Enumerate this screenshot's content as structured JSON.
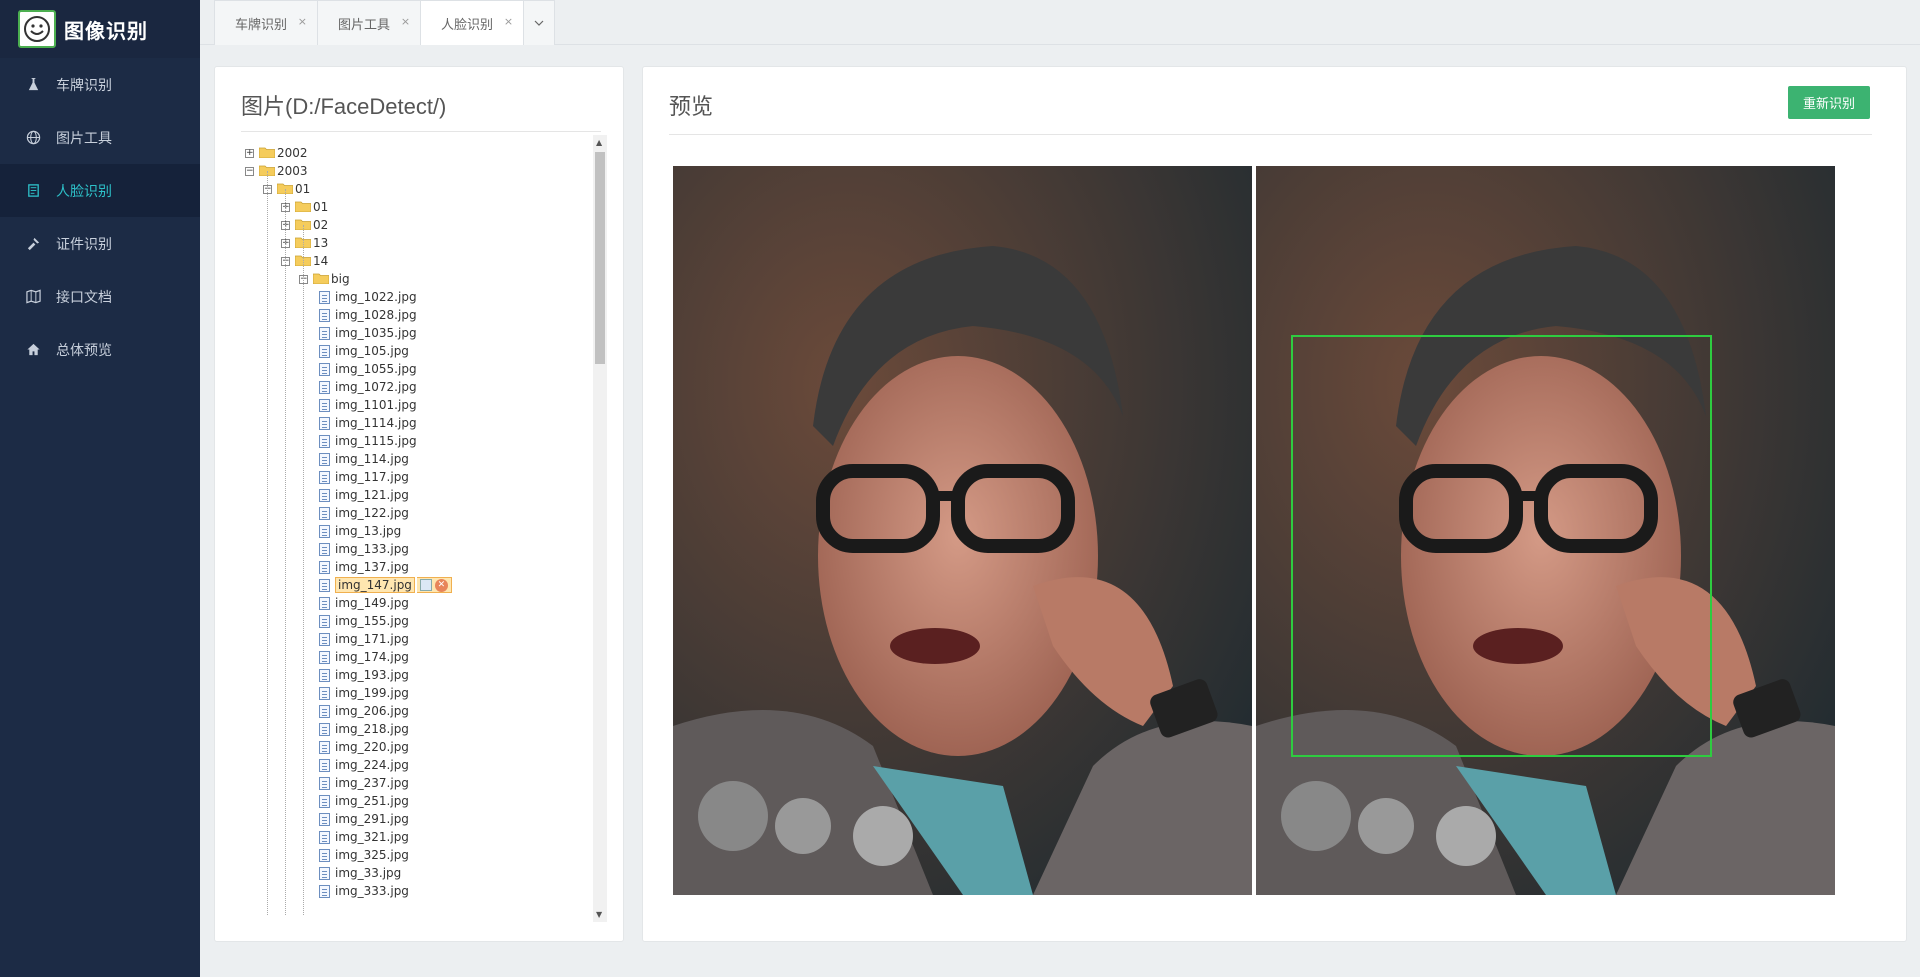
{
  "app": {
    "title": "图像识别",
    "logo_icon": "smiley-face-icon"
  },
  "sidebar": {
    "items": [
      {
        "label": "车牌识别",
        "icon": "flask-icon",
        "active": false
      },
      {
        "label": "图片工具",
        "icon": "globe-icon",
        "active": false
      },
      {
        "label": "人脸识别",
        "icon": "document-icon",
        "active": true
      },
      {
        "label": "证件识别",
        "icon": "tools-icon",
        "active": false
      },
      {
        "label": "接口文档",
        "icon": "map-icon",
        "active": false
      },
      {
        "label": "总体预览",
        "icon": "home-icon",
        "active": false
      }
    ]
  },
  "tabs": [
    {
      "label": "车牌识别",
      "close": "×"
    },
    {
      "label": "图片工具",
      "close": "×"
    },
    {
      "label": "人脸识别",
      "close": "×",
      "active": true
    }
  ],
  "left_panel": {
    "title": "图片(D:/FaceDetect/)"
  },
  "tree": {
    "folders": [
      {
        "label": "2002",
        "switch": "+"
      },
      {
        "label": "2003",
        "switch": "−"
      },
      {
        "label": "01",
        "switch": "−"
      },
      {
        "label": "01",
        "switch": "+"
      },
      {
        "label": "02",
        "switch": "+"
      },
      {
        "label": "13",
        "switch": "+"
      },
      {
        "label": "14",
        "switch": "−"
      },
      {
        "label": "big",
        "switch": "−"
      }
    ],
    "files": [
      "img_1022.jpg",
      "img_1028.jpg",
      "img_1035.jpg",
      "img_105.jpg",
      "img_1055.jpg",
      "img_1072.jpg",
      "img_1101.jpg",
      "img_1114.jpg",
      "img_1115.jpg",
      "img_114.jpg",
      "img_117.jpg",
      "img_121.jpg",
      "img_122.jpg",
      "img_13.jpg",
      "img_133.jpg",
      "img_137.jpg",
      "img_147.jpg",
      "img_149.jpg",
      "img_155.jpg",
      "img_171.jpg",
      "img_174.jpg",
      "img_193.jpg",
      "img_199.jpg",
      "img_206.jpg",
      "img_218.jpg",
      "img_220.jpg",
      "img_224.jpg",
      "img_237.jpg",
      "img_251.jpg",
      "img_291.jpg",
      "img_321.jpg",
      "img_325.jpg",
      "img_33.jpg",
      "img_333.jpg"
    ],
    "selected_file": "img_147.jpg"
  },
  "right_panel": {
    "title": "预览",
    "rebuild_label": "重新识别"
  },
  "colors": {
    "sidebar_bg": "#1c2b45",
    "active_nav": "#2dc0c8",
    "button": "#3cb371",
    "face_box": "#2ecc40"
  }
}
